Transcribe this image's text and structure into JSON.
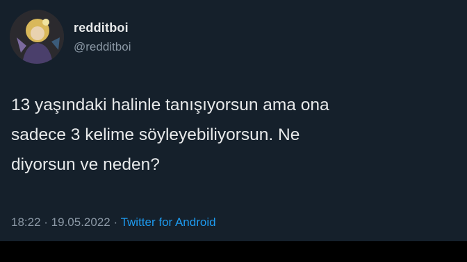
{
  "tweet": {
    "display_name": "redditboi",
    "handle": "@redditboi",
    "text_lines": [
      "13 yaşındaki halinle tanışıyorsun ama ona",
      "sadece 3 kelime söyleyebiliyorsun. Ne",
      "diyorsun ve neden?"
    ],
    "time": "18:22",
    "separator": " · ",
    "date": "19.05.2022",
    "source": "Twitter for Android"
  },
  "colors": {
    "background": "#15202b",
    "text": "#e7e9ea",
    "secondary": "#8b98a5",
    "link": "#1d9bf0"
  }
}
